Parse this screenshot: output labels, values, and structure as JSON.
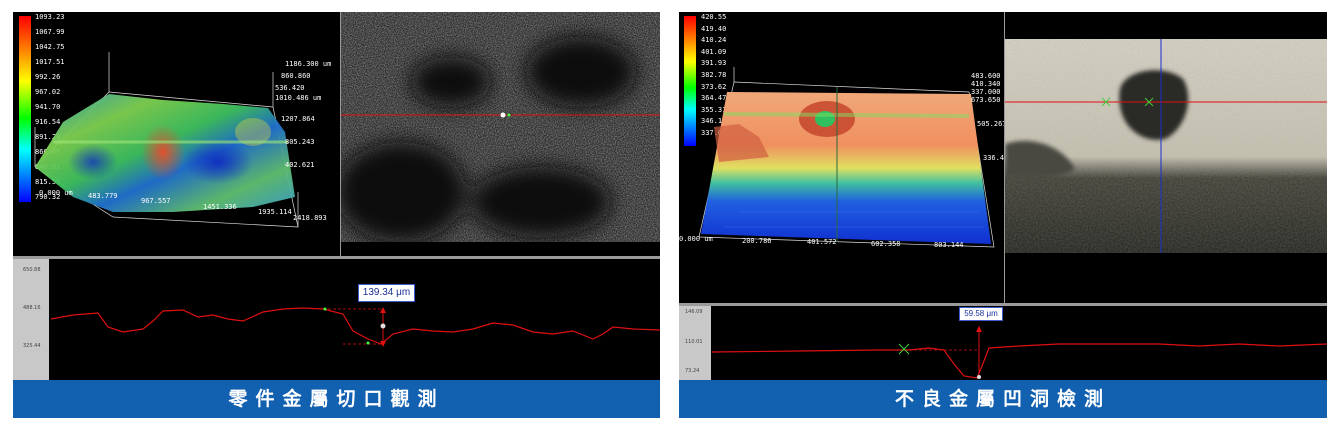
{
  "left": {
    "caption": "零件金屬切口觀測",
    "colorbar_labels": [
      "1093.23",
      "1067.99",
      "1042.75",
      "1017.51",
      "992.26",
      "967.02",
      "941.70",
      "916.54",
      "891.29",
      "866.05",
      "840.81",
      "815.57",
      "790.32"
    ],
    "x_axis_labels": [
      "0.000 um",
      "483.779",
      "967.557",
      "1451.336",
      "1935.114",
      "2418.893"
    ],
    "y_axis_labels": [
      "1186.300 um",
      "860.860",
      "536.420",
      "1010.486 um",
      "1207.864",
      "805.243",
      "402.621"
    ],
    "profile_ticks": [
      "650.88",
      "488.16",
      "325.44"
    ],
    "measurement": "139.34  μm",
    "colors": {
      "profile_line": "#e01010",
      "marker": "#ff4040"
    }
  },
  "right": {
    "caption": "不良金屬凹洞檢測",
    "colorbar_labels": [
      "420.55",
      "419.40",
      "410.24",
      "401.09",
      "391.93",
      "382.78",
      "373.62",
      "364.47",
      "355.31",
      "346.16",
      "337.00"
    ],
    "x_axis_labels": [
      "0.000 um",
      "200.786",
      "401.572",
      "602.358",
      "803.144"
    ],
    "y_axis_labels": [
      "483.600 u",
      "410.340",
      "337.000",
      "673.650 um",
      "505.267",
      "336.4"
    ],
    "profile_ticks": [
      "146.09",
      "110.01",
      "73.24"
    ],
    "measurement": "59.58  μm",
    "colors": {
      "profile_line": "#e01010",
      "crosshair_v": "#1a2fd0",
      "crosshair_h": "#e01010"
    }
  }
}
